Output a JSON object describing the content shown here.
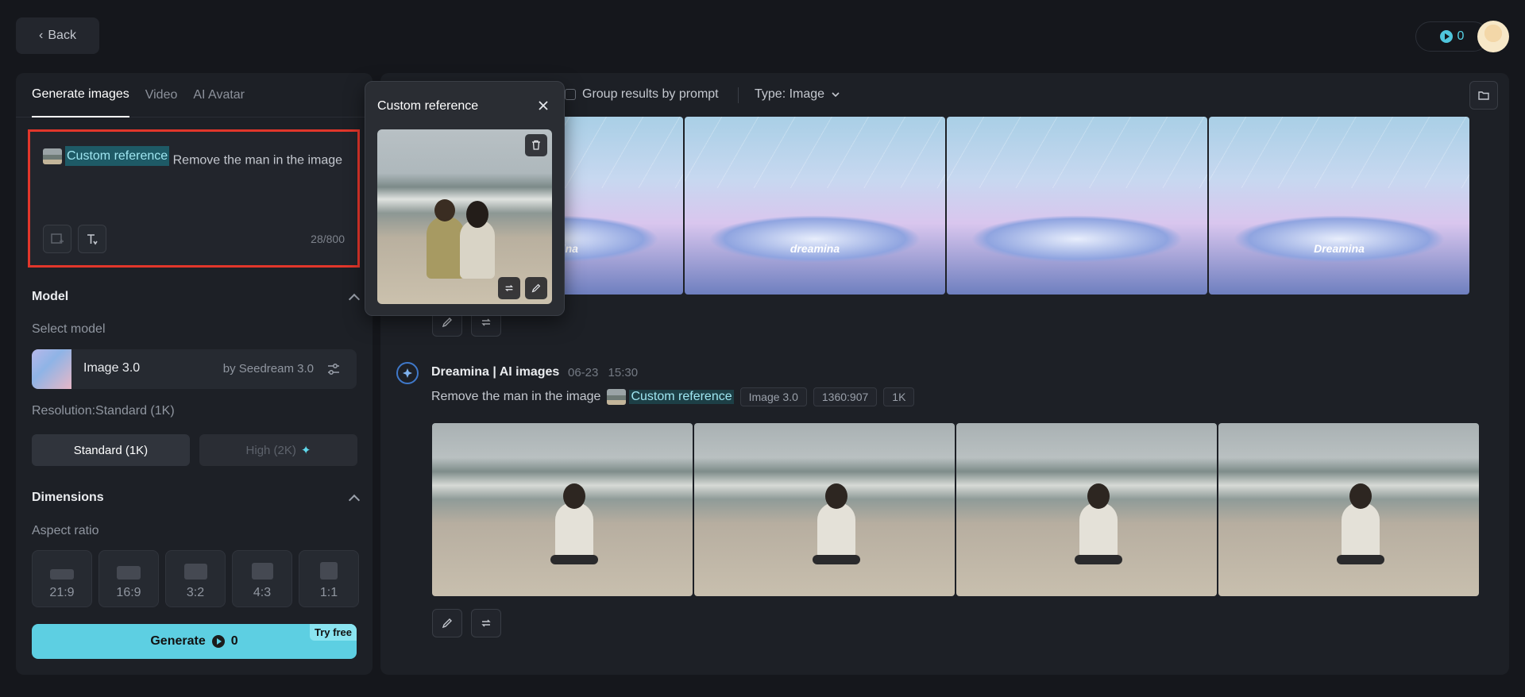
{
  "header": {
    "back_label": "Back",
    "credits": "0"
  },
  "tabs": [
    {
      "label": "Generate images"
    },
    {
      "label": "Video"
    },
    {
      "label": "AI Avatar"
    }
  ],
  "prompt": {
    "reference_label": "Custom reference",
    "text": "Remove the man in the image",
    "counter": "28/800"
  },
  "model_section": {
    "title": "Model",
    "select_label": "Select model",
    "model_name": "Image 3.0",
    "model_by": "by Seedream 3.0",
    "resolution_label": "Resolution:Standard (1K)",
    "res_standard": "Standard (1K)",
    "res_high": "High (2K)"
  },
  "dimensions": {
    "title": "Dimensions",
    "aspect_label": "Aspect ratio",
    "ratios": [
      "21:9",
      "16:9",
      "3:2",
      "4:3",
      "1:1"
    ]
  },
  "generate": {
    "label": "Generate",
    "cost": "0",
    "badge": "Try free"
  },
  "toolbar": {
    "group_label": "Group results by prompt",
    "type_label": "Type: Image"
  },
  "top_row": {
    "labels": [
      "Dreamina",
      "dreamina",
      "",
      "Dreamina"
    ]
  },
  "entry": {
    "title": "Dreamina | AI images",
    "date": "06-23",
    "time": "15:30",
    "prompt": "Remove the man in the image",
    "reference_label": "Custom reference",
    "tags": [
      "Image 3.0",
      "1360:907",
      "1K"
    ]
  },
  "popup": {
    "title": "Custom reference"
  },
  "colors": {
    "accent": "#5dcfe2",
    "highlight_border": "#e2362b",
    "background": "#15171c"
  }
}
